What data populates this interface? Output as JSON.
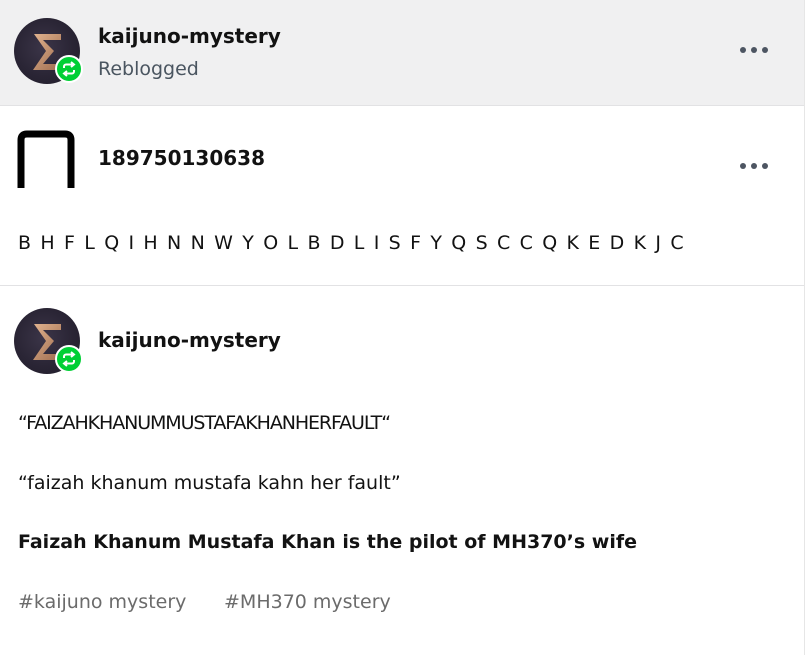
{
  "reblog_header": {
    "blog_name": "kaijuno-mystery",
    "status_label": "Reblogged",
    "avatar_icon": "sigma-icon",
    "badge_icon": "reblog-icon",
    "badge_color": "#00cf35"
  },
  "trail": [
    {
      "username": "189750130638",
      "avatar_icon": "arch-icon",
      "body": "BHFLQIHNNWYOLBDLISFYQSCCQKEDKJC"
    },
    {
      "username": "kaijuno-mystery",
      "avatar_icon": "sigma-icon",
      "badge_icon": "reblog-icon",
      "paragraphs": [
        "“FAIZAHKHANUMMUSTAFAKHANHERFAULT“",
        "“faizah khanum mustafa kahn her fault”"
      ],
      "bold_paragraph": "Faizah Khanum Mustafa Khan is the pilot of MH370’s wife",
      "tags": [
        "#kaijuno mystery",
        "#MH370 mystery"
      ]
    }
  ],
  "more_options_icon": "more-options-icon"
}
